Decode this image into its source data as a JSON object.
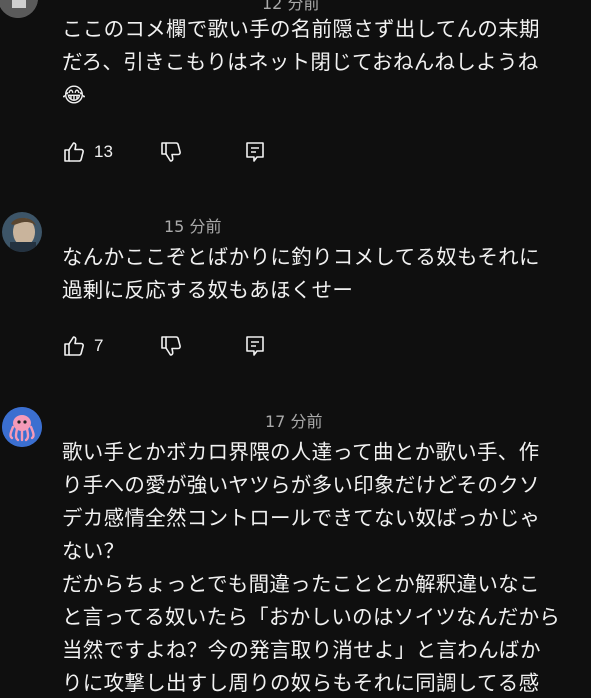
{
  "comments": [
    {
      "time": "12 分前",
      "text": "ここのコメ欄で歌い手の名前隠さず出してんの末期\nだろ、引きこもりはネット閉じておねんねしようね\n😂",
      "likes": "13",
      "avatar_icon": "user-avatar-icon"
    },
    {
      "time": "15 分前",
      "text": "なんかここぞとばかりに釣りコメしてる奴もそれに\n過剰に反応する奴もあほくせー",
      "likes": "7",
      "avatar_icon": "user-avatar-icon"
    },
    {
      "time": "17 分前",
      "text": "歌い手とかボカロ界隈の人達って曲とか歌い手、作\nり手への愛が強いヤツらが多い印象だけどそのクソ\nデカ感情全然コントロールできてない奴ばっかじゃ\nない？\nだからちょっとでも間違ったこととか解釈違いなこ\nと言ってる奴いたら「おかしいのはソイツなんだから\n当然ですよね？今の発言取り消せよ」と言わんばか\nりに攻撃し出すし周りの奴らもそれに同調してる感",
      "likes": "",
      "avatar_icon": "octopus-avatar-icon"
    }
  ],
  "icons": {
    "like": "thumbs-up-icon",
    "dislike": "thumbs-down-icon",
    "reply": "reply-icon"
  },
  "colors": {
    "background": "#0f0f0f",
    "text": "#f1f1f1",
    "secondary_text": "#aaaaaa",
    "octopus_avatar_bg": "#3b6fd0",
    "octopus_color": "#f59ab8"
  }
}
